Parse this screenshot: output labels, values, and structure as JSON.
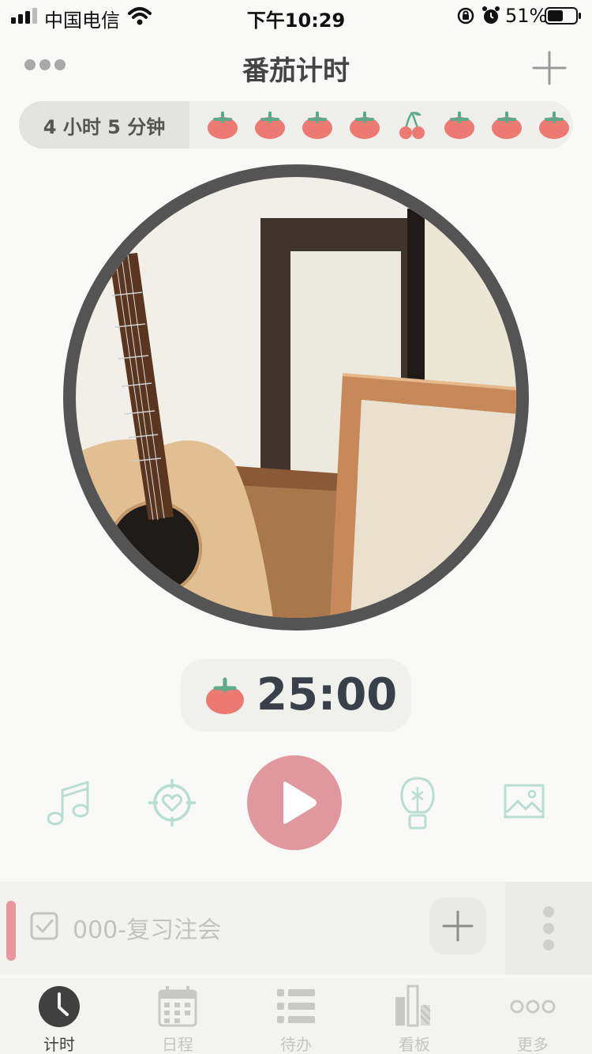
{
  "status_bar": {
    "carrier": "中国电信",
    "time": "下午10:29",
    "battery": "51%",
    "icons": [
      "signal-icon",
      "wifi-icon",
      "rotation-lock-icon",
      "alarm-icon",
      "battery-icon"
    ]
  },
  "nav": {
    "title": "番茄计时",
    "left_icon": "more-dots-icon",
    "right_icon": "plus-icon"
  },
  "summary": {
    "total_time": "4 小时  5 分钟",
    "sessions": [
      "tomato",
      "tomato",
      "tomato",
      "tomato",
      "cherry",
      "tomato",
      "tomato",
      "tomato"
    ]
  },
  "timer": {
    "value": "25:00",
    "icon": "tomato-icon"
  },
  "controls": {
    "music": "music-note-icon",
    "focus": "target-heart-icon",
    "play": "play-icon",
    "idea": "lightbulb-icon",
    "image": "image-icon"
  },
  "task": {
    "label": "000-复习注会",
    "checkbox": "checkbox-icon",
    "add": "plus-icon",
    "menu": "vertical-dots-icon"
  },
  "tabs": [
    {
      "label": "计时",
      "icon": "clock-icon",
      "active": true
    },
    {
      "label": "日程",
      "icon": "calendar-icon",
      "active": false
    },
    {
      "label": "待办",
      "icon": "list-icon",
      "active": false
    },
    {
      "label": "看板",
      "icon": "bar-chart-icon",
      "active": false
    },
    {
      "label": "更多",
      "icon": "more-dots-icon",
      "active": false
    }
  ],
  "colors": {
    "accent_pink": "#e0979d",
    "tomato_red": "#ec7a72",
    "tomato_leaf": "#5dab8a",
    "icon_mint": "#b8ddd2",
    "timer_text": "#3a404a"
  }
}
